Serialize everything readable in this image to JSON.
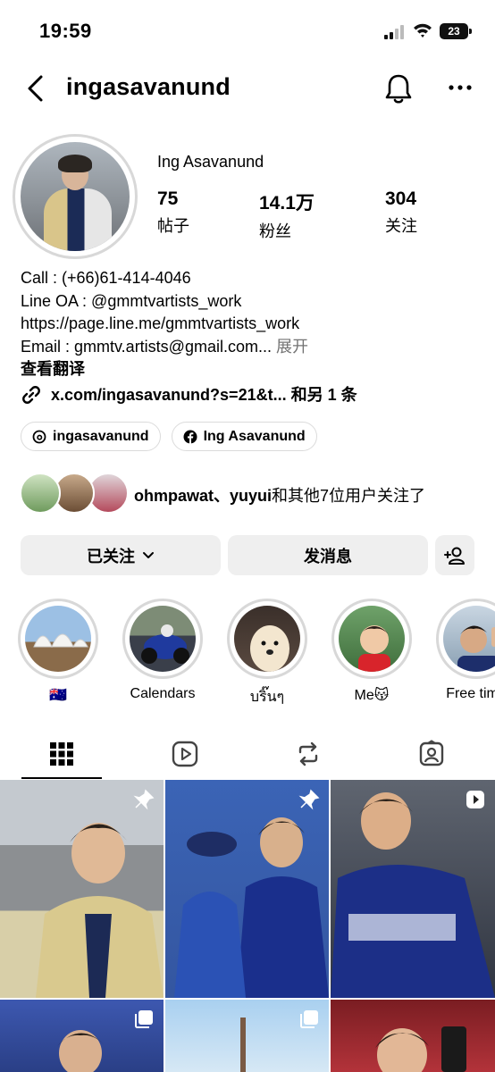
{
  "status": {
    "time": "19:59",
    "battery": "23"
  },
  "header": {
    "username": "ingasavanund"
  },
  "profile": {
    "display_name": "Ing Asavanund",
    "stats": [
      {
        "value": "75",
        "label": "帖子"
      },
      {
        "value": "14.1万",
        "label": "粉丝"
      },
      {
        "value": "304",
        "label": "关注"
      }
    ],
    "bio": [
      "Call : (+66)61-414-4046",
      "Line OA : @gmmtvartists_work",
      "https://page.line.me/gmmtvartists_work",
      "Email : gmmtv.artists@gmail.com..."
    ],
    "more_label": "展开",
    "translate_label": "查看翻译",
    "link_text": "x.com/ingasavanund?s=21&t...",
    "link_more": "和另 1 条",
    "chips": [
      {
        "icon": "threads-icon",
        "label": "ingasavanund"
      },
      {
        "icon": "facebook-icon",
        "label": "Ing Asavanund"
      }
    ],
    "followed_by": {
      "names": "ohmpawat、yuyui",
      "suffix": "和其他7位用户关注了"
    }
  },
  "actions": {
    "following_label": "已关注",
    "message_label": "发消息"
  },
  "highlights": [
    {
      "label": "🇦🇺"
    },
    {
      "label": "Calendars"
    },
    {
      "label": "บริ๊นๆ"
    },
    {
      "label": "Me😽"
    },
    {
      "label": "Free time"
    }
  ],
  "tabs": [
    {
      "icon": "grid-icon"
    },
    {
      "icon": "reels-icon"
    },
    {
      "icon": "reposts-icon"
    },
    {
      "icon": "tagged-icon"
    }
  ],
  "colors": {
    "button_bg": "#efefef",
    "chip_border": "#dbdbdb",
    "secondary_text": "#737373"
  }
}
